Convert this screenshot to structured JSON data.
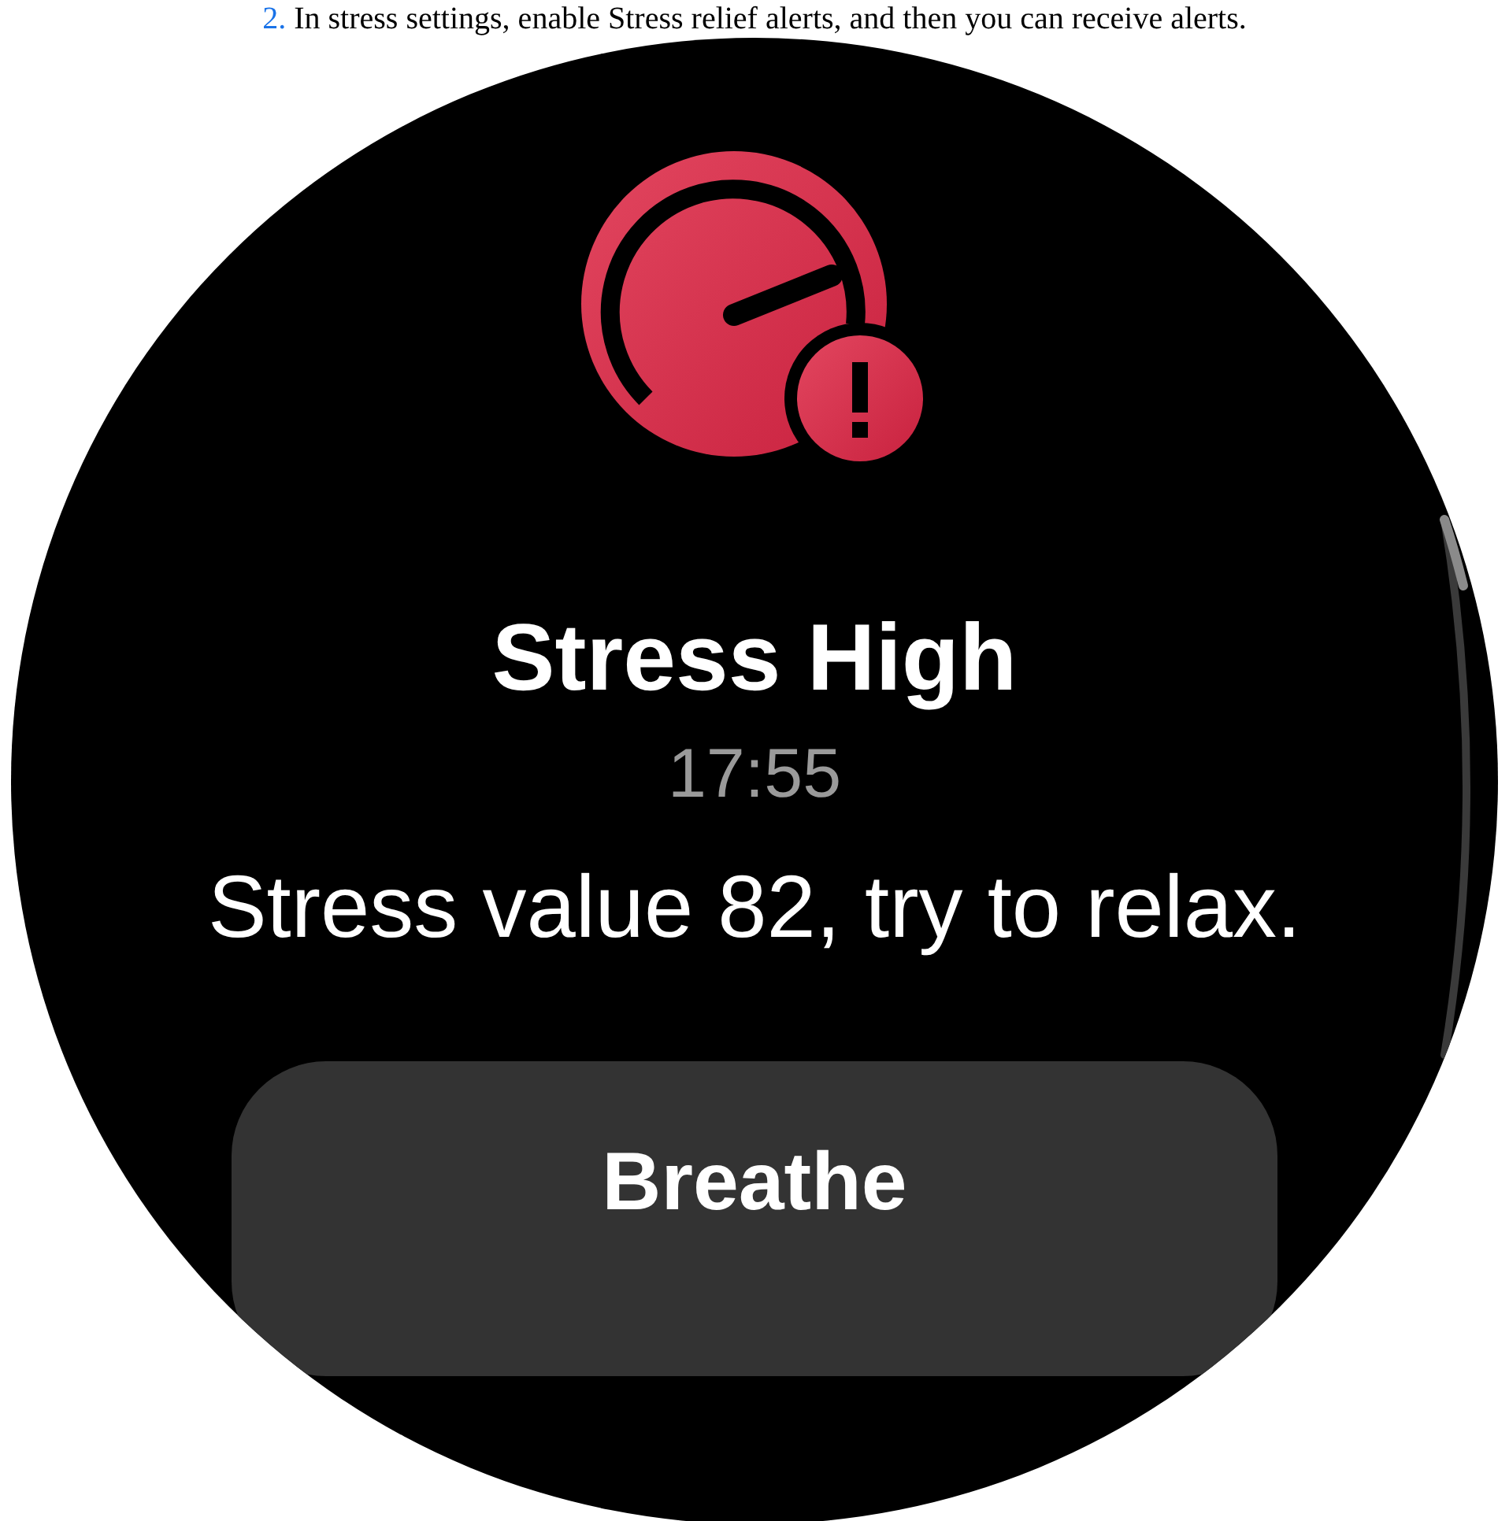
{
  "instruction": {
    "number": "2.",
    "text": "In stress settings, enable Stress relief alerts, and then you can receive alerts."
  },
  "watch": {
    "title": "Stress High",
    "time": "17:55",
    "message": "Stress value 82, try to relax.",
    "button": "Breathe"
  }
}
